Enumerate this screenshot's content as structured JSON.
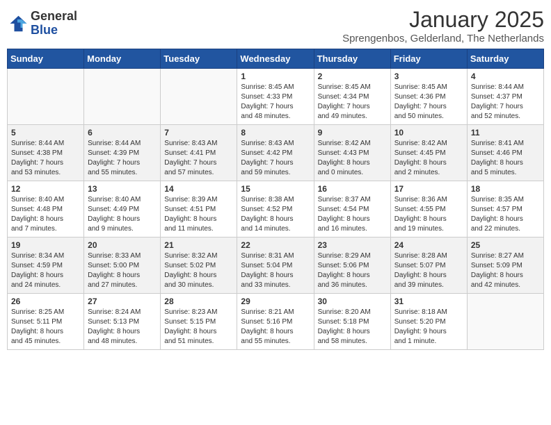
{
  "header": {
    "logo_general": "General",
    "logo_blue": "Blue",
    "month_title": "January 2025",
    "subtitle": "Sprengenbos, Gelderland, The Netherlands"
  },
  "columns": [
    "Sunday",
    "Monday",
    "Tuesday",
    "Wednesday",
    "Thursday",
    "Friday",
    "Saturday"
  ],
  "weeks": [
    [
      {
        "day": "",
        "info": ""
      },
      {
        "day": "",
        "info": ""
      },
      {
        "day": "",
        "info": ""
      },
      {
        "day": "1",
        "info": "Sunrise: 8:45 AM\nSunset: 4:33 PM\nDaylight: 7 hours\nand 48 minutes."
      },
      {
        "day": "2",
        "info": "Sunrise: 8:45 AM\nSunset: 4:34 PM\nDaylight: 7 hours\nand 49 minutes."
      },
      {
        "day": "3",
        "info": "Sunrise: 8:45 AM\nSunset: 4:36 PM\nDaylight: 7 hours\nand 50 minutes."
      },
      {
        "day": "4",
        "info": "Sunrise: 8:44 AM\nSunset: 4:37 PM\nDaylight: 7 hours\nand 52 minutes."
      }
    ],
    [
      {
        "day": "5",
        "info": "Sunrise: 8:44 AM\nSunset: 4:38 PM\nDaylight: 7 hours\nand 53 minutes."
      },
      {
        "day": "6",
        "info": "Sunrise: 8:44 AM\nSunset: 4:39 PM\nDaylight: 7 hours\nand 55 minutes."
      },
      {
        "day": "7",
        "info": "Sunrise: 8:43 AM\nSunset: 4:41 PM\nDaylight: 7 hours\nand 57 minutes."
      },
      {
        "day": "8",
        "info": "Sunrise: 8:43 AM\nSunset: 4:42 PM\nDaylight: 7 hours\nand 59 minutes."
      },
      {
        "day": "9",
        "info": "Sunrise: 8:42 AM\nSunset: 4:43 PM\nDaylight: 8 hours\nand 0 minutes."
      },
      {
        "day": "10",
        "info": "Sunrise: 8:42 AM\nSunset: 4:45 PM\nDaylight: 8 hours\nand 2 minutes."
      },
      {
        "day": "11",
        "info": "Sunrise: 8:41 AM\nSunset: 4:46 PM\nDaylight: 8 hours\nand 5 minutes."
      }
    ],
    [
      {
        "day": "12",
        "info": "Sunrise: 8:40 AM\nSunset: 4:48 PM\nDaylight: 8 hours\nand 7 minutes."
      },
      {
        "day": "13",
        "info": "Sunrise: 8:40 AM\nSunset: 4:49 PM\nDaylight: 8 hours\nand 9 minutes."
      },
      {
        "day": "14",
        "info": "Sunrise: 8:39 AM\nSunset: 4:51 PM\nDaylight: 8 hours\nand 11 minutes."
      },
      {
        "day": "15",
        "info": "Sunrise: 8:38 AM\nSunset: 4:52 PM\nDaylight: 8 hours\nand 14 minutes."
      },
      {
        "day": "16",
        "info": "Sunrise: 8:37 AM\nSunset: 4:54 PM\nDaylight: 8 hours\nand 16 minutes."
      },
      {
        "day": "17",
        "info": "Sunrise: 8:36 AM\nSunset: 4:55 PM\nDaylight: 8 hours\nand 19 minutes."
      },
      {
        "day": "18",
        "info": "Sunrise: 8:35 AM\nSunset: 4:57 PM\nDaylight: 8 hours\nand 22 minutes."
      }
    ],
    [
      {
        "day": "19",
        "info": "Sunrise: 8:34 AM\nSunset: 4:59 PM\nDaylight: 8 hours\nand 24 minutes."
      },
      {
        "day": "20",
        "info": "Sunrise: 8:33 AM\nSunset: 5:00 PM\nDaylight: 8 hours\nand 27 minutes."
      },
      {
        "day": "21",
        "info": "Sunrise: 8:32 AM\nSunset: 5:02 PM\nDaylight: 8 hours\nand 30 minutes."
      },
      {
        "day": "22",
        "info": "Sunrise: 8:31 AM\nSunset: 5:04 PM\nDaylight: 8 hours\nand 33 minutes."
      },
      {
        "day": "23",
        "info": "Sunrise: 8:29 AM\nSunset: 5:06 PM\nDaylight: 8 hours\nand 36 minutes."
      },
      {
        "day": "24",
        "info": "Sunrise: 8:28 AM\nSunset: 5:07 PM\nDaylight: 8 hours\nand 39 minutes."
      },
      {
        "day": "25",
        "info": "Sunrise: 8:27 AM\nSunset: 5:09 PM\nDaylight: 8 hours\nand 42 minutes."
      }
    ],
    [
      {
        "day": "26",
        "info": "Sunrise: 8:25 AM\nSunset: 5:11 PM\nDaylight: 8 hours\nand 45 minutes."
      },
      {
        "day": "27",
        "info": "Sunrise: 8:24 AM\nSunset: 5:13 PM\nDaylight: 8 hours\nand 48 minutes."
      },
      {
        "day": "28",
        "info": "Sunrise: 8:23 AM\nSunset: 5:15 PM\nDaylight: 8 hours\nand 51 minutes."
      },
      {
        "day": "29",
        "info": "Sunrise: 8:21 AM\nSunset: 5:16 PM\nDaylight: 8 hours\nand 55 minutes."
      },
      {
        "day": "30",
        "info": "Sunrise: 8:20 AM\nSunset: 5:18 PM\nDaylight: 8 hours\nand 58 minutes."
      },
      {
        "day": "31",
        "info": "Sunrise: 8:18 AM\nSunset: 5:20 PM\nDaylight: 9 hours\nand 1 minute."
      },
      {
        "day": "",
        "info": ""
      }
    ]
  ]
}
